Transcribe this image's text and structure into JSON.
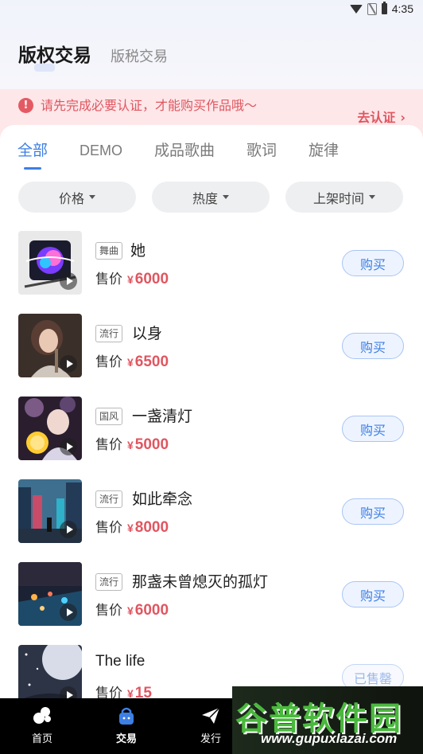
{
  "status_bar": {
    "time": "4:35"
  },
  "header": {
    "tab_main": "版权交易",
    "tab_sub": "版税交易"
  },
  "notice": {
    "message": "请先完成必要认证，才能购买作品哦～",
    "action": "去认证",
    "action_arrow": "›"
  },
  "categories": [
    "全部",
    "DEMO",
    "成品歌曲",
    "歌词",
    "旋律"
  ],
  "filters": [
    "价格",
    "热度",
    "上架时间"
  ],
  "price_label": "售价",
  "currency": "¥",
  "items": [
    {
      "tag": "舞曲",
      "title": "她",
      "price": "6000",
      "button": "购买"
    },
    {
      "tag": "流行",
      "title": "以身",
      "price": "6500",
      "button": "购买"
    },
    {
      "tag": "国风",
      "title": "一盏清灯",
      "price": "5000",
      "button": "购买"
    },
    {
      "tag": "流行",
      "title": "如此牵念",
      "price": "8000",
      "button": "购买"
    },
    {
      "tag": "流行",
      "title": "那盏未曾熄灭的孤灯",
      "price": "6000",
      "button": "购买"
    },
    {
      "tag": "",
      "title": "The life",
      "price": "15",
      "button": "已售罄"
    }
  ],
  "tab_bar": [
    {
      "label": "首页",
      "icon": "home-icon"
    },
    {
      "label": "交易",
      "icon": "bag-icon"
    },
    {
      "label": "发行",
      "icon": "paper-plane-icon"
    }
  ],
  "watermark": {
    "title": "谷普软件园",
    "url": "www.gupuxlazai.com"
  },
  "colors": {
    "accent": "#3d7fe5",
    "price": "#e05660",
    "notice_bg": "#fde7e9"
  }
}
